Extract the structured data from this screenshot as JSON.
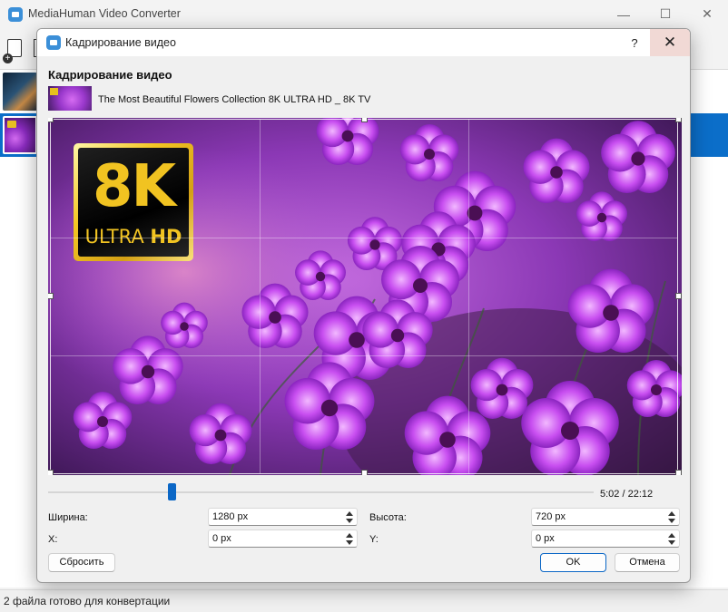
{
  "app": {
    "title": "MediaHuman Video Converter",
    "window_controls": {
      "minimize": "—",
      "maximize": "☐",
      "close": "✕"
    }
  },
  "status_bar": {
    "text": "2 файла готово для конвертации"
  },
  "dialog": {
    "title": "Кадрирование видео",
    "help": "?",
    "close": "✕",
    "heading": "Кадрирование видео",
    "video_name": "The Most Beautiful Flowers Collection 8K ULTRA HD _ 8K TV",
    "preview_badge": {
      "big": "8K",
      "ultra": "ULTRA",
      "hd": "HD"
    },
    "playback": {
      "time": "5:02 / 22:12",
      "position_fraction": 0.227
    },
    "fields": {
      "width_label": "Ширина:",
      "width_value": "1280 px",
      "height_label": "Высота:",
      "height_value": "720 px",
      "x_label": "X:",
      "x_value": "0 px",
      "y_label": "Y:",
      "y_value": "0 px"
    },
    "buttons": {
      "reset": "Сбросить",
      "ok": "OK",
      "cancel": "Отмена"
    }
  },
  "colors": {
    "accent": "#0b67c6",
    "selection": "#0b6ec9",
    "close_hover": "#f1d9d5"
  }
}
